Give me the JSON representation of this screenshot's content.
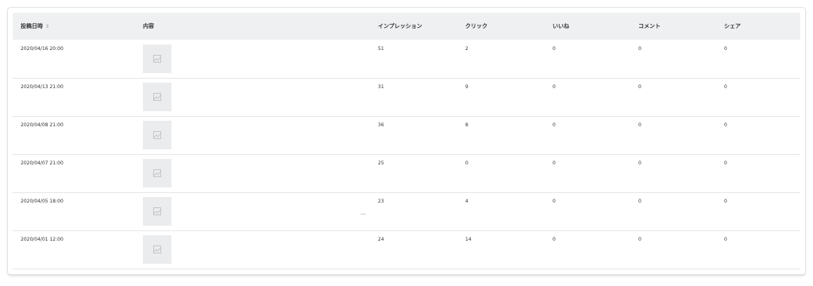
{
  "table": {
    "headers": {
      "date": "投稿日時",
      "content": "内容",
      "impressions": "インプレッション",
      "clicks": "クリック",
      "likes": "いいね",
      "comments": "コメント",
      "shares": "シェア"
    },
    "sort_icon": "sort-icon",
    "rows": [
      {
        "date": "2020/04/16 20:00",
        "impressions": "51",
        "clicks": "2",
        "likes": "0",
        "comments": "0",
        "shares": "0",
        "thumbnail_icon": "image-placeholder-icon"
      },
      {
        "date": "2020/04/13 21:00",
        "impressions": "31",
        "clicks": "9",
        "likes": "0",
        "comments": "0",
        "shares": "0",
        "thumbnail_icon": "image-placeholder-icon"
      },
      {
        "date": "2020/04/08 21:00",
        "impressions": "36",
        "clicks": "8",
        "likes": "0",
        "comments": "0",
        "shares": "0",
        "thumbnail_icon": "image-placeholder-icon"
      },
      {
        "date": "2020/04/07 21:00",
        "impressions": "25",
        "clicks": "0",
        "likes": "0",
        "comments": "0",
        "shares": "0",
        "thumbnail_icon": "image-placeholder-icon"
      },
      {
        "date": "2020/04/05 18:00",
        "impressions": "23",
        "clicks": "4",
        "likes": "0",
        "comments": "0",
        "shares": "0",
        "thumbnail_icon": "image-placeholder-icon",
        "more": "..."
      },
      {
        "date": "2020/04/01 12:00",
        "impressions": "24",
        "clicks": "14",
        "likes": "0",
        "comments": "0",
        "shares": "0",
        "thumbnail_icon": "image-placeholder-icon"
      }
    ]
  },
  "colors": {
    "header_bg": "#eef0f2",
    "thumb_bg": "#ebecee",
    "row_border": "#e6e6e6",
    "text": "#333333"
  }
}
